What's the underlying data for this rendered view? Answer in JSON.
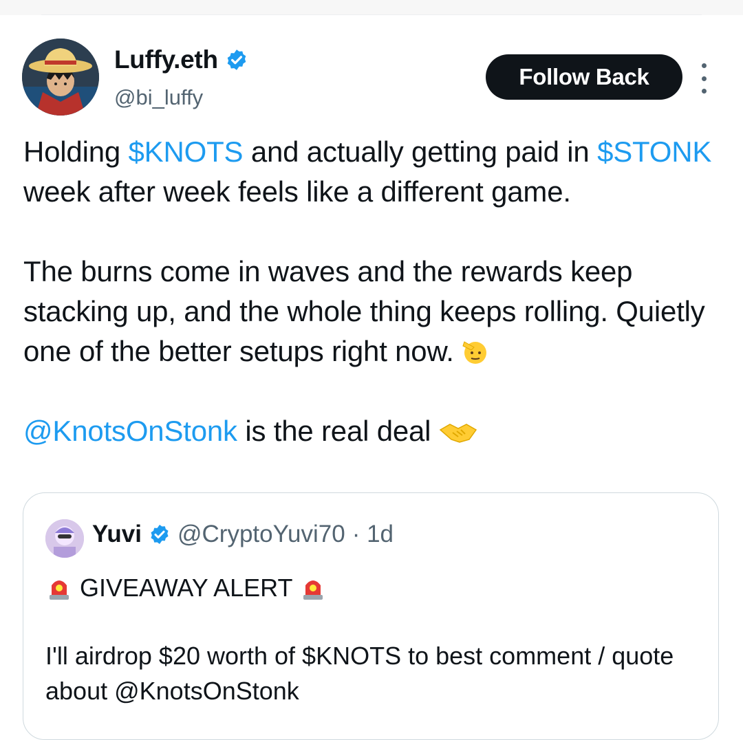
{
  "author": {
    "name": "Luffy.eth",
    "handle": "@bi_luffy",
    "verified": true,
    "avatar_icon": "straw-hat-avatar"
  },
  "follow_button": {
    "label": "Follow Back"
  },
  "tweet": {
    "p1_ticker1": "$KNOTS",
    "p1_text1": " and actually getting paid in",
    "p1_ticker2": "$STONK",
    "p1_text2": " week after week feels like a different game.",
    "p1_lead": "Holding ",
    "p2": "The burns come in waves and the rewards keep stacking up, and the whole thing keeps rolling. Quietly one of the better setups right now.",
    "p2_emoji": "saluting-face",
    "p3_mention": "@KnotsOnStonk",
    "p3_text": " is the real deal",
    "p3_emoji": "handshake"
  },
  "quoted": {
    "name": "Yuvi",
    "handle": "@CryptoYuvi70",
    "time": "· 1d",
    "verified": true,
    "headline": "GIVEAWAY ALERT",
    "headline_emoji": "police-siren",
    "body": "I'll airdrop $20 worth of $KNOTS to best comment / quote about @KnotsOnStonk"
  },
  "colors": {
    "link": "#1d9bf0",
    "verified": "#1d9bf0",
    "text": "#0f1419",
    "secondary": "#536471",
    "button": "#0f1419"
  }
}
